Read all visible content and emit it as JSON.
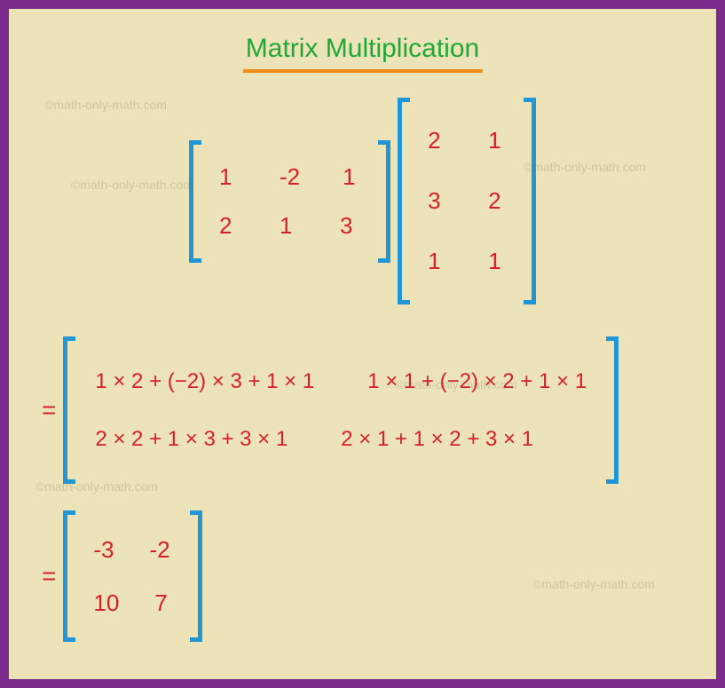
{
  "title": "Matrix Multiplication",
  "watermark": "©math-only-math.com",
  "matrixA": {
    "r0": {
      "c0": "1",
      "c1": "-2",
      "c2": "1"
    },
    "r1": {
      "c0": "2",
      "c1": "1",
      "c2": "3"
    }
  },
  "matrixB": {
    "r0": {
      "c0": "2",
      "c1": "1"
    },
    "r1": {
      "c0": "3",
      "c1": "2"
    },
    "r2": {
      "c0": "1",
      "c1": "1"
    }
  },
  "expanded": {
    "r0": {
      "c0": "1 × 2 + (−2) × 3 + 1 × 1",
      "c1": "1 × 1 + (−2) × 2 + 1 × 1"
    },
    "r1": {
      "c0": "2 × 2 + 1 × 3 + 3 × 1",
      "c1": "2 × 1 + 1 × 2 + 3 × 1"
    }
  },
  "result": {
    "r0": {
      "c0": "-3",
      "c1": "-2"
    },
    "r1": {
      "c0": "10",
      "c1": "7"
    }
  },
  "equals": "="
}
